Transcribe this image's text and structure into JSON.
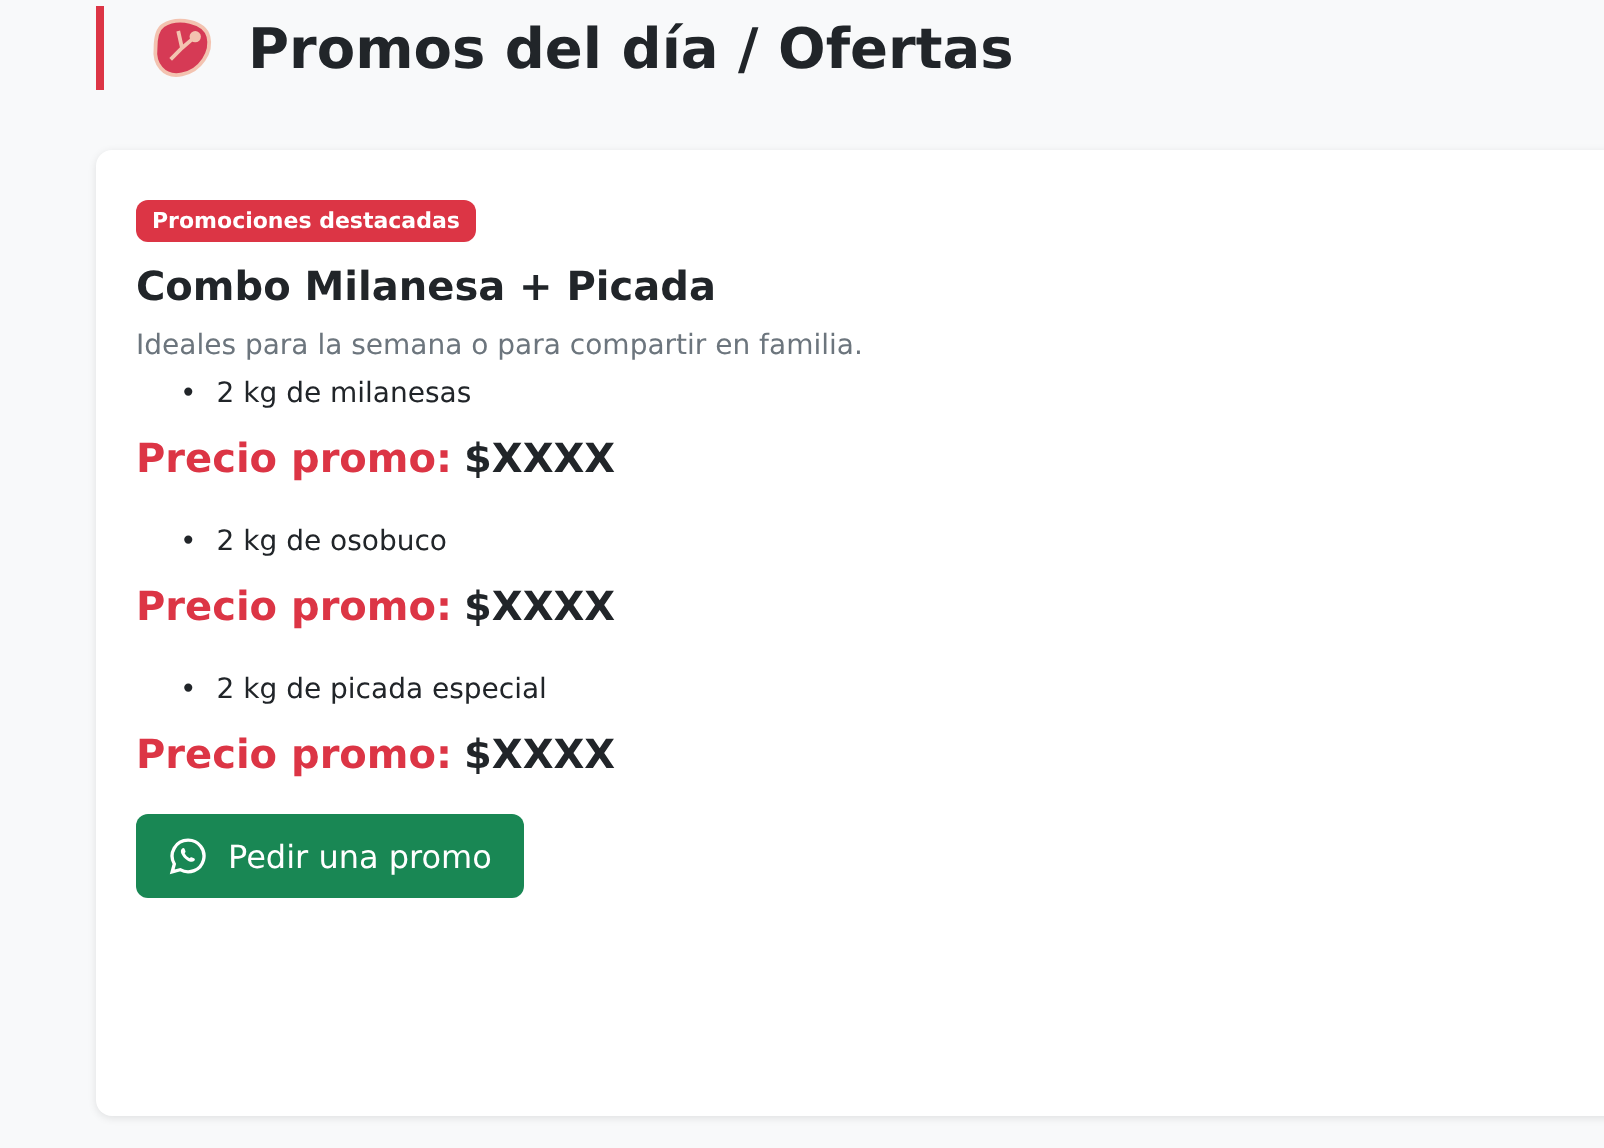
{
  "header": {
    "title": "Promos del día / Ofertas"
  },
  "card": {
    "badge": "Promociones destacadas",
    "title": "Combo Milanesa + Picada",
    "subtitle": "Ideales para la semana o para compartir en familia.",
    "promos": [
      {
        "items": [
          {
            "bullet": "•",
            "text": "2 kg de milanesas"
          }
        ],
        "price_label": "Precio promo:",
        "price": "$XXXX"
      },
      {
        "items": [
          {
            "bullet": "•",
            "text": "2 kg de osobuco"
          }
        ],
        "price_label": "Precio promo:",
        "price": "$XXXX"
      },
      {
        "items": [
          {
            "bullet": "•",
            "text": "2 kg de picada especial"
          }
        ],
        "price_label": "Precio promo:",
        "price": "$XXXX"
      }
    ],
    "button": "Pedir una promo"
  }
}
